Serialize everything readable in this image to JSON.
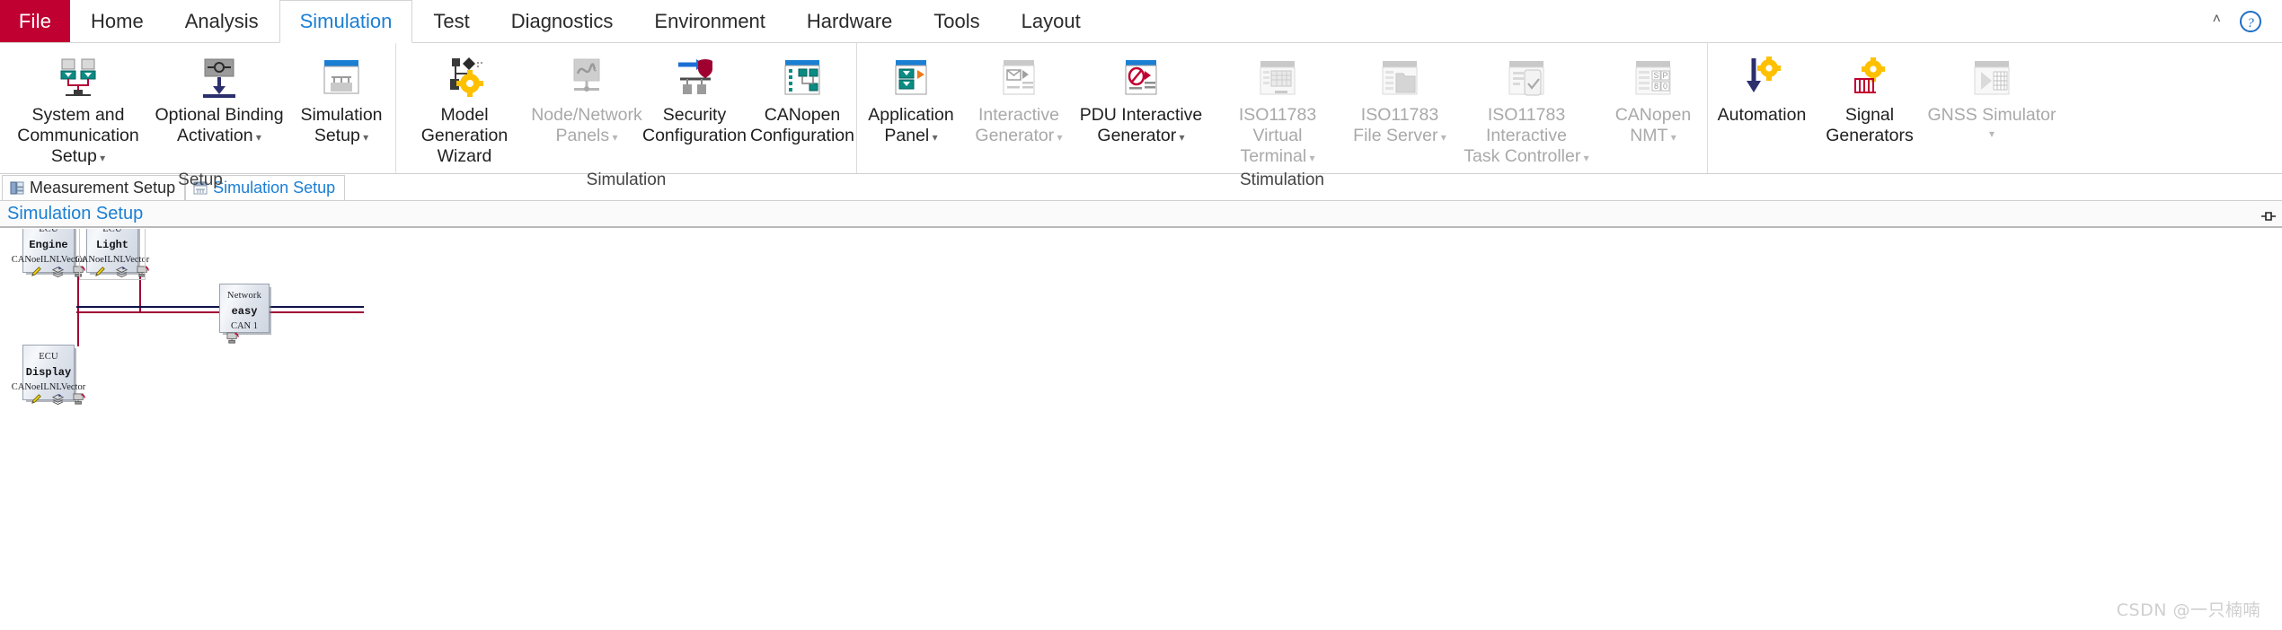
{
  "tabs": {
    "file_label": "File",
    "items": [
      {
        "label": "Home",
        "active": false
      },
      {
        "label": "Analysis",
        "active": false
      },
      {
        "label": "Simulation",
        "active": true
      },
      {
        "label": "Test",
        "active": false
      },
      {
        "label": "Diagnostics",
        "active": false
      },
      {
        "label": "Environment",
        "active": false
      },
      {
        "label": "Hardware",
        "active": false
      },
      {
        "label": "Tools",
        "active": false
      },
      {
        "label": "Layout",
        "active": false
      }
    ],
    "collapse_caret": "˄",
    "help_title": "?"
  },
  "ribbon": {
    "groups": [
      {
        "title": "Setup",
        "buttons": [
          {
            "label": "System and\nCommunication Setup",
            "icon": "system-communication-setup-icon",
            "disabled": false,
            "caret": true,
            "width": "w160"
          },
          {
            "label": "Optional Binding\nActivation",
            "icon": "optional-binding-activation-icon",
            "disabled": false,
            "caret": true,
            "width": "w150"
          },
          {
            "label": "Simulation\nSetup",
            "icon": "simulation-setup-icon",
            "disabled": false,
            "caret": true,
            "width": "w118"
          }
        ]
      },
      {
        "title": "Simulation",
        "buttons": [
          {
            "label": "Model Generation\nWizard",
            "icon": "model-generation-wizard-icon",
            "disabled": false,
            "caret": false,
            "width": "w150"
          },
          {
            "label": "Node/Network\nPanels",
            "icon": "node-network-panels-icon",
            "disabled": true,
            "caret": true,
            "width": "w118"
          },
          {
            "label": "Security\nConfiguration",
            "icon": "security-configuration-icon",
            "disabled": false,
            "caret": false,
            "width": "w118"
          },
          {
            "label": "CANopen\nConfiguration",
            "icon": "canopen-configuration-icon",
            "disabled": false,
            "caret": false,
            "width": "w118"
          }
        ]
      },
      {
        "title": "Stimulation",
        "buttons": [
          {
            "label": "Application\nPanel",
            "icon": "application-panel-icon",
            "disabled": false,
            "caret": true,
            "width": "w118"
          },
          {
            "label": "Interactive\nGenerator",
            "icon": "interactive-generator-icon",
            "disabled": true,
            "caret": true,
            "width": "w118"
          },
          {
            "label": "PDU Interactive\nGenerator",
            "icon": "pdu-interactive-generator-icon",
            "disabled": false,
            "caret": true,
            "width": "w150"
          },
          {
            "label": "ISO11783 Virtual\nTerminal",
            "icon": "iso11783-virtual-terminal-icon",
            "disabled": true,
            "caret": true,
            "width": "w150"
          },
          {
            "label": "ISO11783\nFile Server",
            "icon": "iso11783-file-server-icon",
            "disabled": true,
            "caret": true,
            "width": "w118"
          },
          {
            "label": "ISO11783 Interactive\nTask Controller",
            "icon": "iso11783-task-controller-icon",
            "disabled": true,
            "caret": true,
            "width": "w160"
          },
          {
            "label": "CANopen\nNMT",
            "icon": "canopen-nmt-icon",
            "disabled": true,
            "caret": true,
            "width": "w118"
          }
        ]
      },
      {
        "title": "",
        "buttons": [
          {
            "label": "Automation",
            "icon": "automation-icon",
            "disabled": false,
            "caret": false,
            "width": "w118"
          },
          {
            "label": "Signal\nGenerators",
            "icon": "signal-generators-icon",
            "disabled": false,
            "caret": false,
            "width": "w118"
          },
          {
            "label": "GNSS Simulator",
            "icon": "gnss-simulator-icon",
            "disabled": true,
            "caret": true,
            "width": "w150"
          }
        ]
      }
    ]
  },
  "doctabs": [
    {
      "label": "Measurement Setup",
      "active": false
    },
    {
      "label": "Simulation Setup",
      "active": true
    }
  ],
  "document": {
    "header_title": "Simulation Setup"
  },
  "diagram": {
    "nodes": [
      {
        "kind": "ECU",
        "name": "Engine",
        "sub": "CANoeILNLVector",
        "selected": false,
        "tools": [
          "edit-pencil-icon",
          "layers-icon",
          "network-monitor-icon"
        ]
      },
      {
        "kind": "ECU",
        "name": "Light",
        "sub": "CANoeILNLVector",
        "selected": true,
        "tools": [
          "edit-pencil-icon",
          "layers-icon",
          "network-monitor-icon"
        ]
      },
      {
        "kind": "ECU",
        "name": "Display",
        "sub": "CANoeILNLVector",
        "selected": false,
        "tools": [
          "edit-pencil-icon",
          "layers-icon",
          "network-monitor-icon"
        ]
      },
      {
        "kind": "Network",
        "name": "easy",
        "sub": "CAN 1",
        "selected": false,
        "tools": [
          "network-monitor-icon"
        ]
      }
    ],
    "bus_color_primary": "#a10035",
    "bus_color_secondary": "#12124a"
  },
  "watermark": "CSDN @一只楠喃"
}
